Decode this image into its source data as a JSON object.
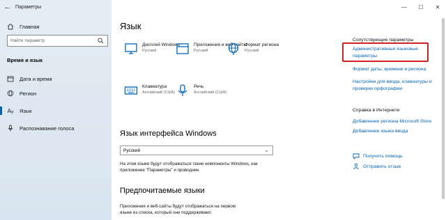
{
  "window": {
    "title": "Параметры",
    "minimize": "—",
    "maximize": "☐",
    "close": "✕"
  },
  "sidebar": {
    "home_label": "Главная",
    "search_placeholder": "Найти параметр",
    "section_title": "Время и язык",
    "items": [
      {
        "label": "Дата и время"
      },
      {
        "label": "Регион"
      },
      {
        "label": "Язык"
      },
      {
        "label": "Распознавание голоса"
      }
    ]
  },
  "main": {
    "title": "Язык",
    "tiles": [
      {
        "label": "Дисплей Windows",
        "sub": "Русский"
      },
      {
        "label": "Приложения и веб-сайты",
        "sub": "Русский"
      },
      {
        "label": "Формат региона",
        "sub": "Русский"
      },
      {
        "label": "Клавиатура",
        "sub": "Английский (США)"
      },
      {
        "label": "Речь",
        "sub": "Английский (США)"
      }
    ],
    "interface_heading": "Язык интерфейса Windows",
    "interface_value": "Русский",
    "interface_desc_1": "На этом языке будут отображаться такие компоненты Windows, как",
    "interface_desc_2": "приложение \"Параметры\" и проводник.",
    "preferred_heading": "Предпочитаемые языки",
    "preferred_desc_1": "Приложения и веб-сайты будут отображаться на первом",
    "preferred_desc_2": "языке из списка, который они поддерживают."
  },
  "related": {
    "heading": "Сопутствующие параметры",
    "link_admin": "Административные языковые параметры",
    "link_admin_1": "Административные языковые",
    "link_admin_2": "параметры",
    "link_format": "Формат даты, времени и региона",
    "link_input_1": "Настройки для ввода, клавиатуры и",
    "link_input_2": "проверки орфографии"
  },
  "help": {
    "heading": "Справка в Интернете",
    "link_store": "Добавление региона Microsoft Store",
    "link_add_lang": "Добавление языка ввода",
    "get_help": "Получить помощь",
    "feedback": "Отправить отзыв"
  },
  "colors": {
    "accent": "#0063b1",
    "highlight_border": "#d32020"
  }
}
